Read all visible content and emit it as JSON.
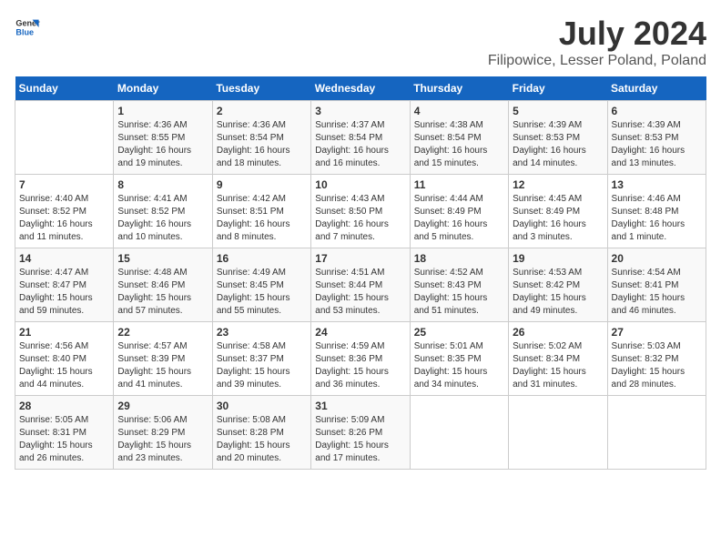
{
  "header": {
    "logo_general": "General",
    "logo_blue": "Blue",
    "title": "July 2024",
    "subtitle": "Filipowice, Lesser Poland, Poland"
  },
  "calendar": {
    "weekdays": [
      "Sunday",
      "Monday",
      "Tuesday",
      "Wednesday",
      "Thursday",
      "Friday",
      "Saturday"
    ],
    "weeks": [
      [
        {
          "day": "",
          "sunrise": "",
          "sunset": "",
          "daylight": ""
        },
        {
          "day": "1",
          "sunrise": "Sunrise: 4:36 AM",
          "sunset": "Sunset: 8:55 PM",
          "daylight": "Daylight: 16 hours and 19 minutes."
        },
        {
          "day": "2",
          "sunrise": "Sunrise: 4:36 AM",
          "sunset": "Sunset: 8:54 PM",
          "daylight": "Daylight: 16 hours and 18 minutes."
        },
        {
          "day": "3",
          "sunrise": "Sunrise: 4:37 AM",
          "sunset": "Sunset: 8:54 PM",
          "daylight": "Daylight: 16 hours and 16 minutes."
        },
        {
          "day": "4",
          "sunrise": "Sunrise: 4:38 AM",
          "sunset": "Sunset: 8:54 PM",
          "daylight": "Daylight: 16 hours and 15 minutes."
        },
        {
          "day": "5",
          "sunrise": "Sunrise: 4:39 AM",
          "sunset": "Sunset: 8:53 PM",
          "daylight": "Daylight: 16 hours and 14 minutes."
        },
        {
          "day": "6",
          "sunrise": "Sunrise: 4:39 AM",
          "sunset": "Sunset: 8:53 PM",
          "daylight": "Daylight: 16 hours and 13 minutes."
        }
      ],
      [
        {
          "day": "7",
          "sunrise": "Sunrise: 4:40 AM",
          "sunset": "Sunset: 8:52 PM",
          "daylight": "Daylight: 16 hours and 11 minutes."
        },
        {
          "day": "8",
          "sunrise": "Sunrise: 4:41 AM",
          "sunset": "Sunset: 8:52 PM",
          "daylight": "Daylight: 16 hours and 10 minutes."
        },
        {
          "day": "9",
          "sunrise": "Sunrise: 4:42 AM",
          "sunset": "Sunset: 8:51 PM",
          "daylight": "Daylight: 16 hours and 8 minutes."
        },
        {
          "day": "10",
          "sunrise": "Sunrise: 4:43 AM",
          "sunset": "Sunset: 8:50 PM",
          "daylight": "Daylight: 16 hours and 7 minutes."
        },
        {
          "day": "11",
          "sunrise": "Sunrise: 4:44 AM",
          "sunset": "Sunset: 8:49 PM",
          "daylight": "Daylight: 16 hours and 5 minutes."
        },
        {
          "day": "12",
          "sunrise": "Sunrise: 4:45 AM",
          "sunset": "Sunset: 8:49 PM",
          "daylight": "Daylight: 16 hours and 3 minutes."
        },
        {
          "day": "13",
          "sunrise": "Sunrise: 4:46 AM",
          "sunset": "Sunset: 8:48 PM",
          "daylight": "Daylight: 16 hours and 1 minute."
        }
      ],
      [
        {
          "day": "14",
          "sunrise": "Sunrise: 4:47 AM",
          "sunset": "Sunset: 8:47 PM",
          "daylight": "Daylight: 15 hours and 59 minutes."
        },
        {
          "day": "15",
          "sunrise": "Sunrise: 4:48 AM",
          "sunset": "Sunset: 8:46 PM",
          "daylight": "Daylight: 15 hours and 57 minutes."
        },
        {
          "day": "16",
          "sunrise": "Sunrise: 4:49 AM",
          "sunset": "Sunset: 8:45 PM",
          "daylight": "Daylight: 15 hours and 55 minutes."
        },
        {
          "day": "17",
          "sunrise": "Sunrise: 4:51 AM",
          "sunset": "Sunset: 8:44 PM",
          "daylight": "Daylight: 15 hours and 53 minutes."
        },
        {
          "day": "18",
          "sunrise": "Sunrise: 4:52 AM",
          "sunset": "Sunset: 8:43 PM",
          "daylight": "Daylight: 15 hours and 51 minutes."
        },
        {
          "day": "19",
          "sunrise": "Sunrise: 4:53 AM",
          "sunset": "Sunset: 8:42 PM",
          "daylight": "Daylight: 15 hours and 49 minutes."
        },
        {
          "day": "20",
          "sunrise": "Sunrise: 4:54 AM",
          "sunset": "Sunset: 8:41 PM",
          "daylight": "Daylight: 15 hours and 46 minutes."
        }
      ],
      [
        {
          "day": "21",
          "sunrise": "Sunrise: 4:56 AM",
          "sunset": "Sunset: 8:40 PM",
          "daylight": "Daylight: 15 hours and 44 minutes."
        },
        {
          "day": "22",
          "sunrise": "Sunrise: 4:57 AM",
          "sunset": "Sunset: 8:39 PM",
          "daylight": "Daylight: 15 hours and 41 minutes."
        },
        {
          "day": "23",
          "sunrise": "Sunrise: 4:58 AM",
          "sunset": "Sunset: 8:37 PM",
          "daylight": "Daylight: 15 hours and 39 minutes."
        },
        {
          "day": "24",
          "sunrise": "Sunrise: 4:59 AM",
          "sunset": "Sunset: 8:36 PM",
          "daylight": "Daylight: 15 hours and 36 minutes."
        },
        {
          "day": "25",
          "sunrise": "Sunrise: 5:01 AM",
          "sunset": "Sunset: 8:35 PM",
          "daylight": "Daylight: 15 hours and 34 minutes."
        },
        {
          "day": "26",
          "sunrise": "Sunrise: 5:02 AM",
          "sunset": "Sunset: 8:34 PM",
          "daylight": "Daylight: 15 hours and 31 minutes."
        },
        {
          "day": "27",
          "sunrise": "Sunrise: 5:03 AM",
          "sunset": "Sunset: 8:32 PM",
          "daylight": "Daylight: 15 hours and 28 minutes."
        }
      ],
      [
        {
          "day": "28",
          "sunrise": "Sunrise: 5:05 AM",
          "sunset": "Sunset: 8:31 PM",
          "daylight": "Daylight: 15 hours and 26 minutes."
        },
        {
          "day": "29",
          "sunrise": "Sunrise: 5:06 AM",
          "sunset": "Sunset: 8:29 PM",
          "daylight": "Daylight: 15 hours and 23 minutes."
        },
        {
          "day": "30",
          "sunrise": "Sunrise: 5:08 AM",
          "sunset": "Sunset: 8:28 PM",
          "daylight": "Daylight: 15 hours and 20 minutes."
        },
        {
          "day": "31",
          "sunrise": "Sunrise: 5:09 AM",
          "sunset": "Sunset: 8:26 PM",
          "daylight": "Daylight: 15 hours and 17 minutes."
        },
        {
          "day": "",
          "sunrise": "",
          "sunset": "",
          "daylight": ""
        },
        {
          "day": "",
          "sunrise": "",
          "sunset": "",
          "daylight": ""
        },
        {
          "day": "",
          "sunrise": "",
          "sunset": "",
          "daylight": ""
        }
      ]
    ]
  }
}
